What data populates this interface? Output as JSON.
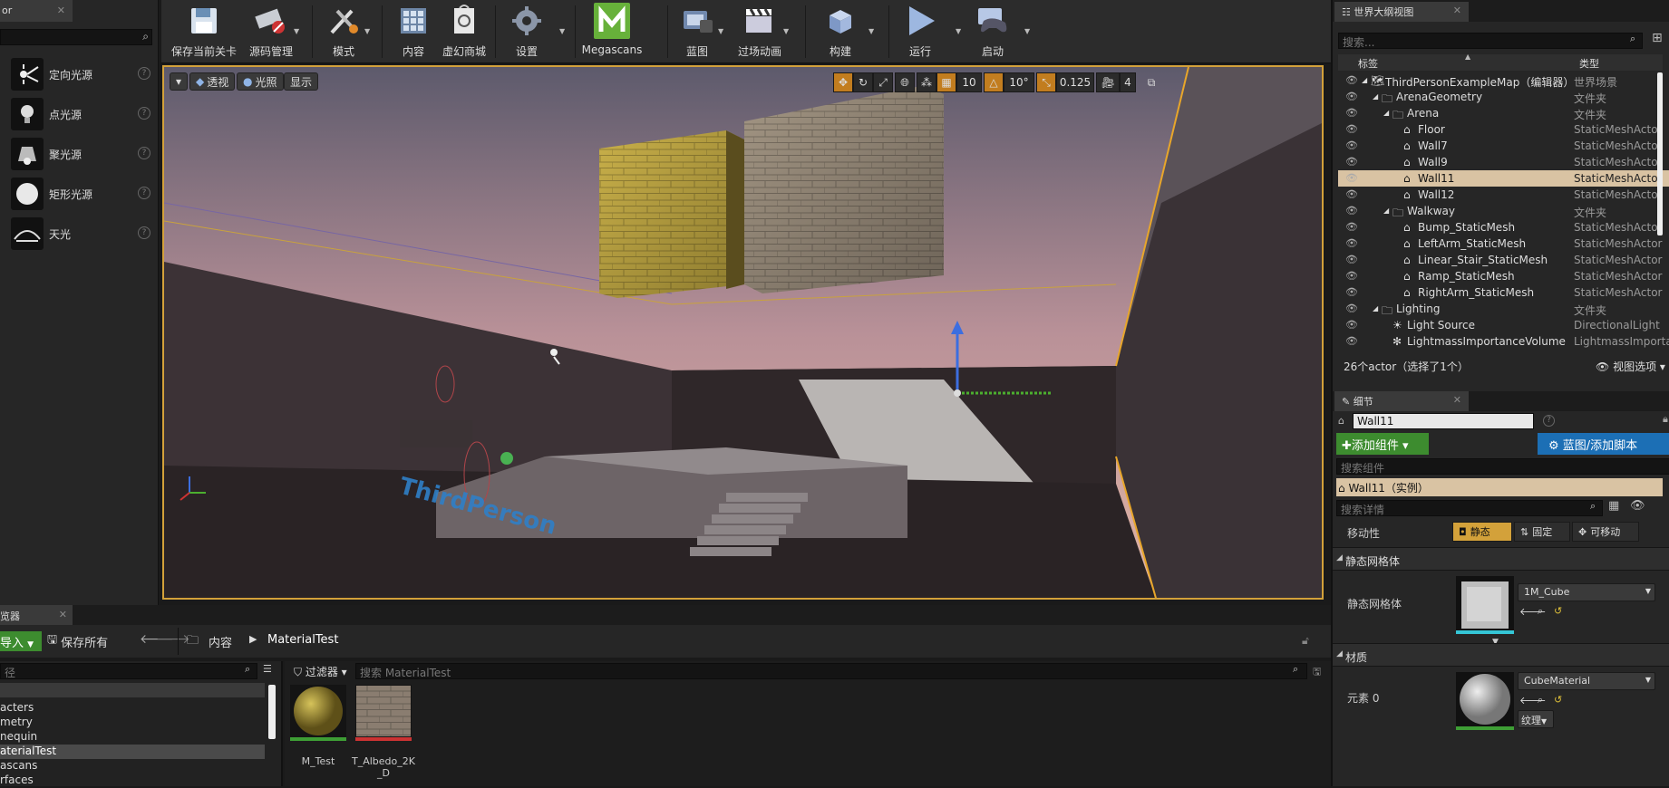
{
  "place_panel": {
    "tab_label": "or",
    "items": [
      {
        "label": "定向光源",
        "icon": "directional-light-icon"
      },
      {
        "label": "点光源",
        "icon": "point-light-icon"
      },
      {
        "label": "聚光源",
        "icon": "spot-light-icon"
      },
      {
        "label": "矩形光源",
        "icon": "rect-light-icon"
      },
      {
        "label": "天光",
        "icon": "sky-light-icon"
      }
    ]
  },
  "toolbar": {
    "save": "保存当前关卡",
    "source_control": "源码管理",
    "modes": "模式",
    "content": "内容",
    "marketplace": "虚幻商城",
    "settings": "设置",
    "megascans": "Megascans",
    "blueprints": "蓝图",
    "cinematics": "过场动画",
    "build": "构建",
    "play": "运行",
    "launch": "启动"
  },
  "viewport": {
    "perspective": "透视",
    "lit": "光照",
    "show": "显示",
    "grid_snap": "10",
    "rot_snap": "10°",
    "scale_snap": "0.125",
    "camera_speed": "4",
    "floor_text": "ThirdPerson"
  },
  "content_browser": {
    "tab_label": "览器",
    "import": "导入",
    "save_all": "保存所有",
    "breadcrumb": [
      "内容",
      "MaterialTest"
    ],
    "path_placeholder": "径",
    "filters": "过滤器",
    "search_placeholder": "搜索 MaterialTest",
    "folders": [
      "acters",
      "metry",
      "nequin",
      "aterialTest",
      "ascans",
      "rfaces"
    ],
    "selected_folder_index": 3,
    "assets": [
      {
        "name": "M_Test"
      },
      {
        "name": "T_Albedo_2K_D"
      }
    ]
  },
  "outliner": {
    "tab_label": "世界大纲视图",
    "search_placeholder": "搜索...",
    "col_label": "标签",
    "col_type": "类型",
    "rows": [
      {
        "name": "ThirdPersonExampleMap（编辑器）",
        "type": "世界场景",
        "indent": 0,
        "kind": "world"
      },
      {
        "name": "ArenaGeometry",
        "type": "文件夹",
        "indent": 1,
        "kind": "folder"
      },
      {
        "name": "Arena",
        "type": "文件夹",
        "indent": 2,
        "kind": "folder"
      },
      {
        "name": "Floor",
        "type": "StaticMeshActor",
        "indent": 3,
        "kind": "mesh"
      },
      {
        "name": "Wall7",
        "type": "StaticMeshActor",
        "indent": 3,
        "kind": "mesh"
      },
      {
        "name": "Wall9",
        "type": "StaticMeshActor",
        "indent": 3,
        "kind": "mesh"
      },
      {
        "name": "Wall11",
        "type": "StaticMeshActor",
        "indent": 3,
        "kind": "mesh",
        "selected": true
      },
      {
        "name": "Wall12",
        "type": "StaticMeshActor",
        "indent": 3,
        "kind": "mesh"
      },
      {
        "name": "Walkway",
        "type": "文件夹",
        "indent": 2,
        "kind": "folder"
      },
      {
        "name": "Bump_StaticMesh",
        "type": "StaticMeshActor",
        "indent": 3,
        "kind": "mesh"
      },
      {
        "name": "LeftArm_StaticMesh",
        "type": "StaticMeshActor",
        "indent": 3,
        "kind": "mesh"
      },
      {
        "name": "Linear_Stair_StaticMesh",
        "type": "StaticMeshActor",
        "indent": 3,
        "kind": "mesh"
      },
      {
        "name": "Ramp_StaticMesh",
        "type": "StaticMeshActor",
        "indent": 3,
        "kind": "mesh"
      },
      {
        "name": "RightArm_StaticMesh",
        "type": "StaticMeshActor",
        "indent": 3,
        "kind": "mesh"
      },
      {
        "name": "Lighting",
        "type": "文件夹",
        "indent": 1,
        "kind": "folder"
      },
      {
        "name": "Light Source",
        "type": "DirectionalLight",
        "indent": 2,
        "kind": "light"
      },
      {
        "name": "LightmassImportanceVolume",
        "type": "LightmassImporta",
        "indent": 2,
        "kind": "volume"
      }
    ],
    "footer": "26个actor（选择了1个）",
    "view_options": "视图选项"
  },
  "details": {
    "tab_label": "细节",
    "actor_name": "Wall11",
    "add_component": "添加组件",
    "blueprint_btn": "蓝图/添加脚本",
    "search_components": "搜索组件",
    "component_row": "Wall11（实例）",
    "search_details": "搜索详情",
    "mobility_label": "移动性",
    "mobility_options": [
      "静态",
      "固定",
      "可移动"
    ],
    "static_mesh_section": "静态网格体",
    "static_mesh_label": "静态网格体",
    "static_mesh_value": "1M_Cube",
    "materials_section": "材质",
    "element_label": "元素 0",
    "material_value": "CubeMaterial",
    "texture_btn": "纹理"
  },
  "colors": {
    "selection": "#d3a13a",
    "green": "#3d8c2f",
    "blue_btn": "#1c6fb5"
  }
}
